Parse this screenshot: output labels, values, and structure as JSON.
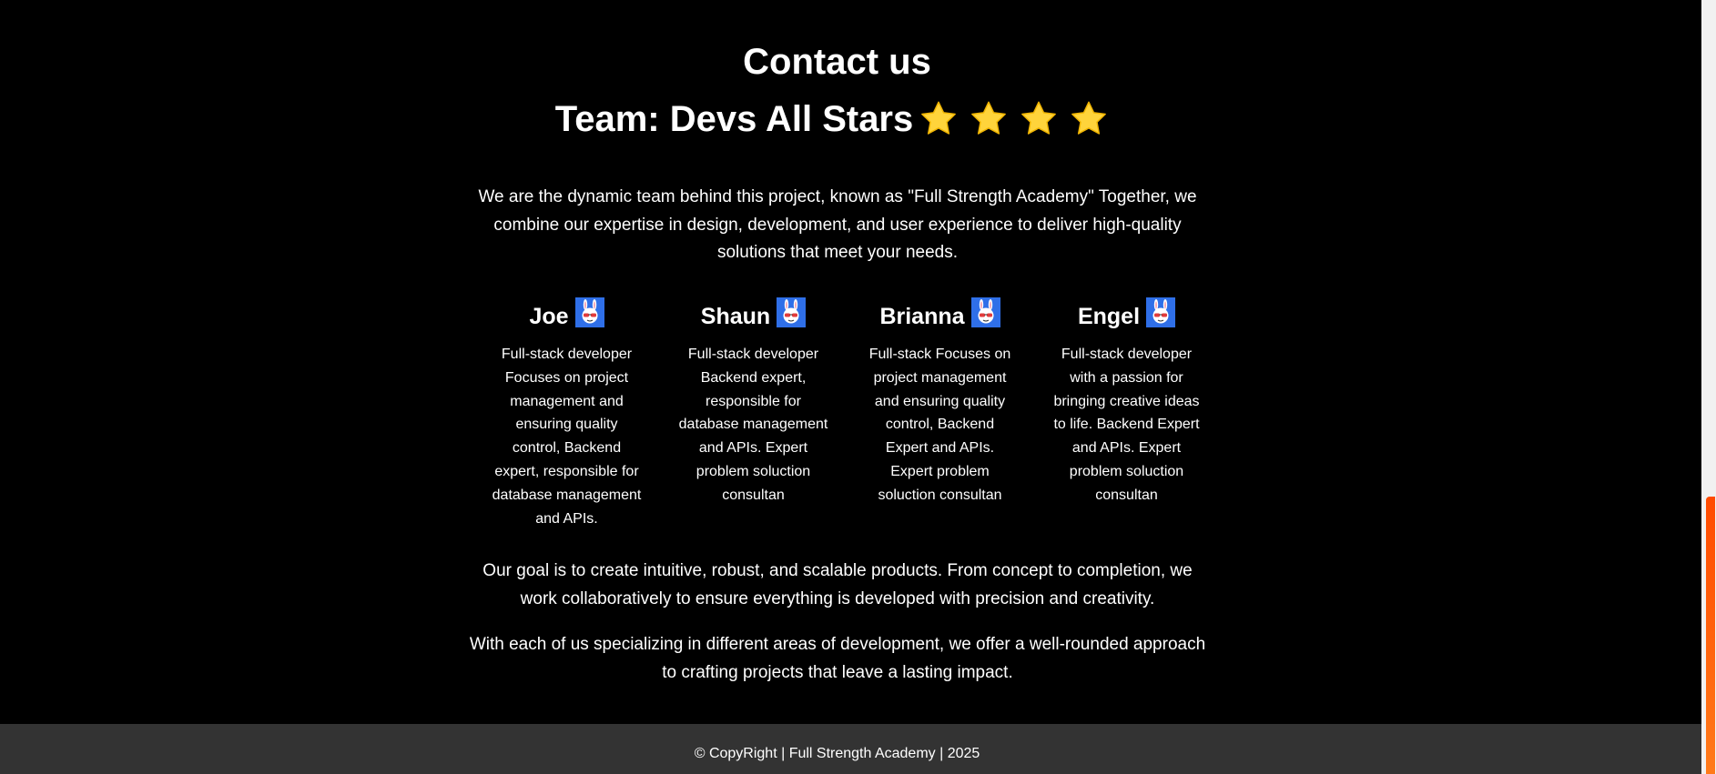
{
  "contact": {
    "heading": "Contact us",
    "team_title": "Team: Devs All Stars",
    "star_icons": [
      "star-icon",
      "star-icon",
      "star-icon",
      "star-icon"
    ],
    "intro": "We are the dynamic team behind this project, known as \"Full Strength Academy\" Together, we combine our expertise in design, development, and user experience to deliver high-quality solutions that meet your needs.",
    "members": [
      {
        "name": "Joe",
        "icon": "bunny-avatar-icon",
        "description": "Full-stack developer Focuses on project management and ensuring quality control, Backend expert, responsible for database management and APIs."
      },
      {
        "name": "Shaun",
        "icon": "bunny-avatar-icon",
        "description": "Full-stack developer Backend expert, responsible for database management and APIs. Expert problem soluction consultan"
      },
      {
        "name": "Brianna",
        "icon": "bunny-avatar-icon",
        "description": "Full-stack Focuses on project management and ensuring quality control, Backend Expert and APIs. Expert problem soluction consultan"
      },
      {
        "name": "Engel",
        "icon": "bunny-avatar-icon",
        "description": "Full-stack developer with a passion for bringing creative ideas to life. Backend Expert and APIs. Expert problem soluction consultan"
      }
    ],
    "goal": "Our goal is to create intuitive, robust, and scalable products. From concept to completion, we work collaboratively to ensure everything is developed with precision and creativity.",
    "approach": "With each of us specializing in different areas of development, we offer a well-rounded approach to crafting projects that leave a lasting impact."
  },
  "footer": {
    "copyright": "© CopyRight | Full Strength Academy | 2025"
  },
  "colors": {
    "background": "#000000",
    "text": "#ffffff",
    "footer_bg": "#333333",
    "star": "#ffd43b",
    "avatar_bg": "#2f6fe8",
    "scroll_thumb": "#ff5a00"
  }
}
